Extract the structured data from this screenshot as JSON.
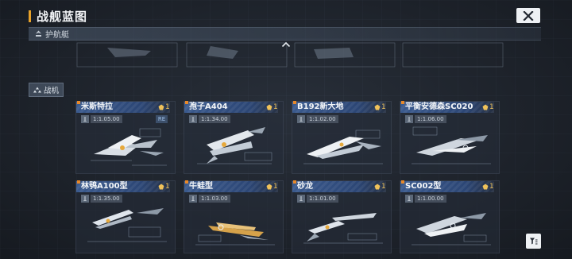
{
  "header": {
    "title": "战舰蓝图"
  },
  "section": {
    "label": "护航艇"
  },
  "category": {
    "label": "战机"
  },
  "colors": {
    "accent": "#e8a22a",
    "badge": "#f0c25a",
    "card_header": "#3a5a8e"
  },
  "icons": {
    "close": "close-icon",
    "section": "escort-icon",
    "category": "fighter-group-icon",
    "collapse": "chevron-up-icon",
    "badge": "badge-icon",
    "scale": "scale-icon",
    "filter": "filter-icon"
  },
  "cards": [
    {
      "name": "米斯特拉",
      "badge": "1",
      "scale": "1:1.05.00",
      "tag": "RE"
    },
    {
      "name": "孢子A404",
      "badge": "1",
      "scale": "1:1.34.00"
    },
    {
      "name": "B192新大地",
      "badge": "1",
      "scale": "1:1.02.00"
    },
    {
      "name": "平衡安德森SC020",
      "badge": "1",
      "scale": "1:1.06.00"
    },
    {
      "name": "林鸮A100型",
      "badge": "1",
      "scale": "1:1.35.00"
    },
    {
      "name": "牛蛙型",
      "badge": "1",
      "scale": "1:1.03.00"
    },
    {
      "name": "砂龙",
      "badge": "1",
      "scale": "1:1.01.00"
    },
    {
      "name": "SC002型",
      "badge": "1",
      "scale": "1:1.00.00"
    }
  ]
}
